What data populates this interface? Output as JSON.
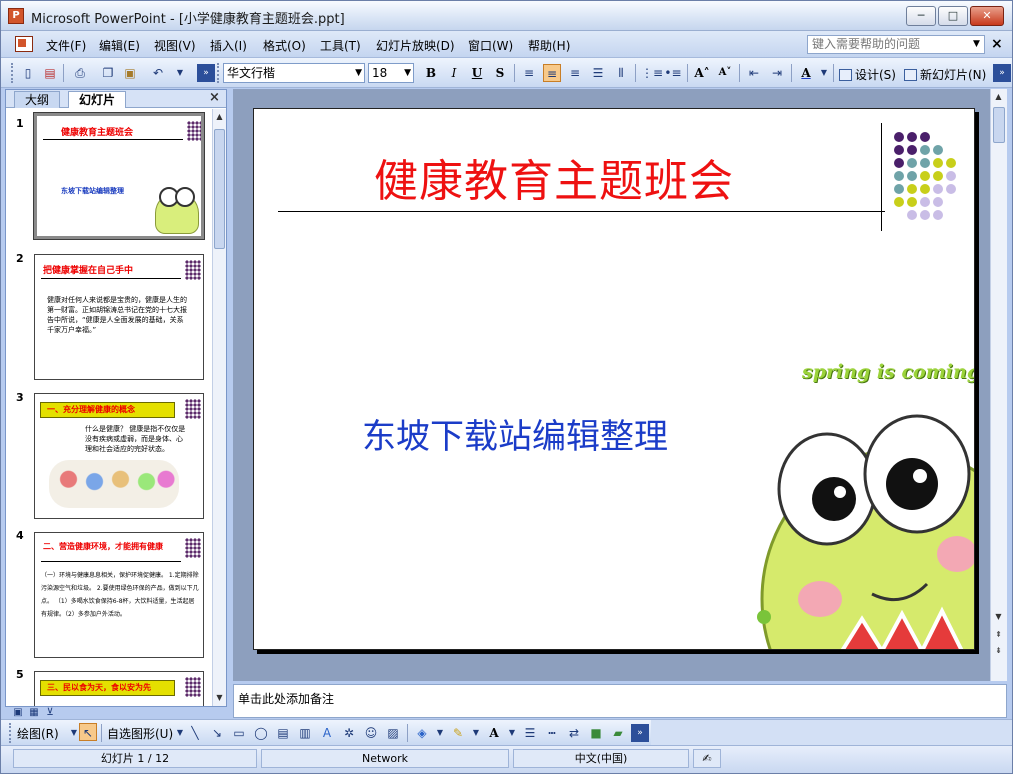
{
  "window": {
    "title": "Microsoft PowerPoint - [小学健康教育主题班会.ppt]",
    "app_icon": "powerpoint-icon",
    "minimize": "─",
    "maximize": "□",
    "close": "✕"
  },
  "menu": {
    "items": [
      "文件(F)",
      "编辑(E)",
      "视图(V)",
      "插入(I)",
      "格式(O)",
      "工具(T)",
      "幻灯片放映(D)",
      "窗口(W)",
      "帮助(H)"
    ],
    "help_placeholder": "键入需要帮助的问题",
    "doc_close": "×"
  },
  "toolbar": {
    "font": "华文行楷",
    "size": "18",
    "bold": "B",
    "italic": "I",
    "underline": "U",
    "shadow": "S",
    "design_label": "设计(S)",
    "new_slide_label": "新幻灯片(N)"
  },
  "pane": {
    "tab_outline": "大纲",
    "tab_slides": "幻灯片",
    "close": "×",
    "thumbs": [
      {
        "num": "1",
        "title": "健康教育主题班会",
        "body": "东坡下载站编辑整理"
      },
      {
        "num": "2",
        "title": "把健康掌握在自己手中",
        "body": "健康对任何人来说都是宝贵的，健康是人生的第一财富。正如胡锦涛总书记在党的十七大报告中所说，“健康是人全面发展的基础，关系千家万户幸福。”"
      },
      {
        "num": "3",
        "title": "一、充分理解健康的概念",
        "body": "什么是健康？    健康是指不仅仅是没有疾病或虚弱，而是身体、心理和社会适应的完好状态。"
      },
      {
        "num": "4",
        "title": "二、营造健康环境，才能拥有健康",
        "body": "（一）环境与健康息息相关，保护环境促健康。  1.定期排除污染源空气和垃圾。  2.要使用绿色环保的产品，做到以下几点。 （1）多喝水饮食保持6-8杯，大饮料适量，生活起居有规律。（2）多参加户外活动。"
      },
      {
        "num": "5",
        "title": "三、民以食为天，食以安为先",
        "body": ""
      }
    ]
  },
  "slide": {
    "title": "健康教育主题班会",
    "subtitle": "东坡下载站编辑整理",
    "decoration_text": "spring is coming~"
  },
  "notes": {
    "placeholder": "单击此处添加备注"
  },
  "drawing": {
    "draw_label": "绘图(R)",
    "autoshapes_label": "自选图形(U)"
  },
  "status": {
    "slide_counter": "幻灯片 1 / 12",
    "design": "Network",
    "language": "中文(中国)"
  },
  "colors": {
    "title_red": "#ee1111",
    "subtitle_blue": "#1b3cc8",
    "dot_purple": "#4a1f6a",
    "dot_teal": "#6fa3a8",
    "dot_yellow": "#c8cf1a",
    "dot_lavender": "#c9bde6"
  }
}
